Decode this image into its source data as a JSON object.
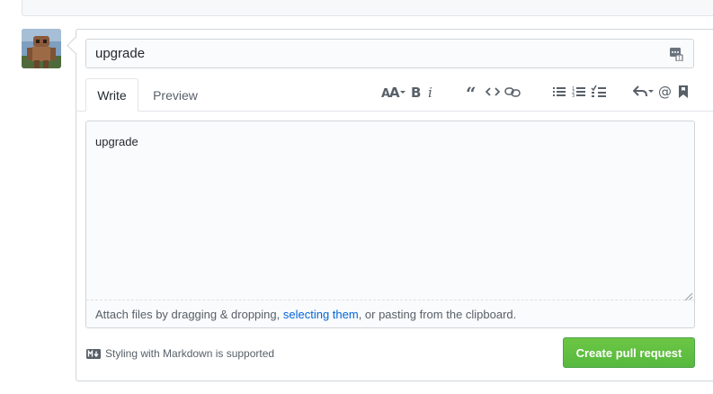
{
  "form": {
    "title_value": "upgrade",
    "tabs": [
      {
        "label": "Write",
        "active": true
      },
      {
        "label": "Preview",
        "active": false
      }
    ],
    "toolbar": [
      {
        "group": "text",
        "items": [
          "header-icon",
          "bold-icon",
          "italic-icon"
        ]
      },
      {
        "group": "insert",
        "items": [
          "quote-icon",
          "code-icon",
          "link-icon"
        ]
      },
      {
        "group": "lists",
        "items": [
          "unordered-list-icon",
          "ordered-list-icon",
          "task-list-icon"
        ]
      },
      {
        "group": "misc",
        "items": [
          "reply-icon",
          "mention-icon",
          "bookmark-icon"
        ]
      }
    ],
    "body_value": "upgrade",
    "attach": {
      "prefix": "Attach files by dragging & dropping, ",
      "link": "selecting them",
      "suffix": ", or pasting from the clipboard."
    },
    "markdown_hint": "Styling with Markdown is supported",
    "submit_label": "Create pull request"
  },
  "colors": {
    "submit": "#6cc644",
    "link": "#0366d6",
    "border": "#d1d5da",
    "muted": "#586069"
  }
}
